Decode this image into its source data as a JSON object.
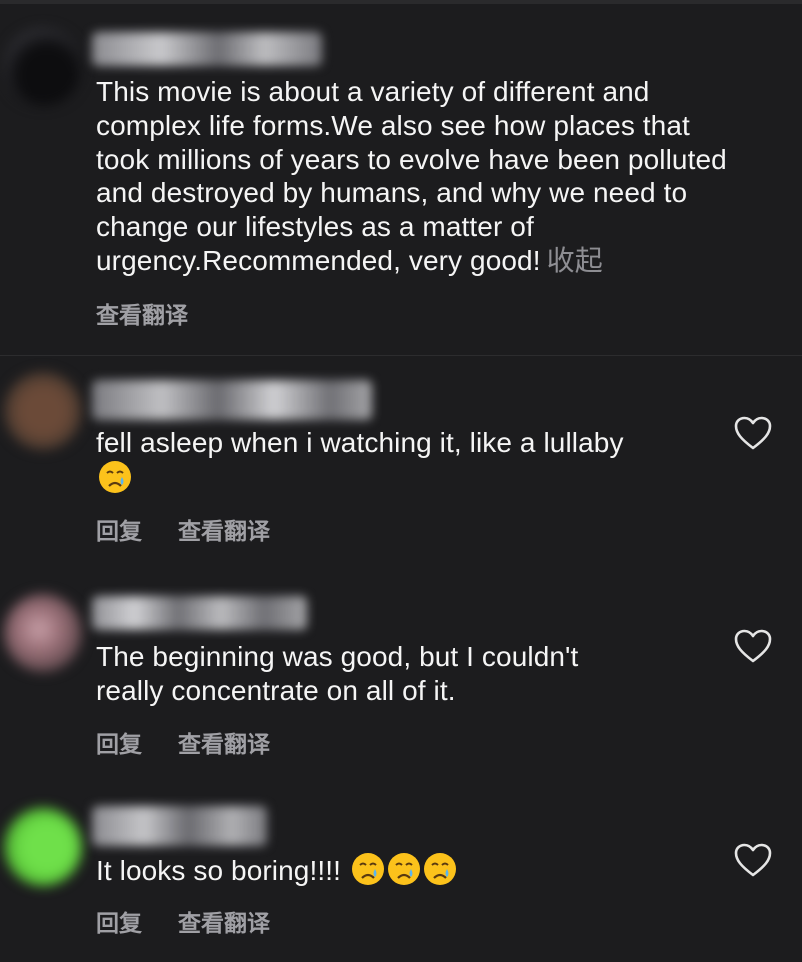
{
  "comments": [
    {
      "text_lines": [
        "This movie is about a variety of different and",
        "complex life forms.We also see how places that",
        "took millions of years to evolve have been polluted",
        "and destroyed by humans, and why we need to",
        "change our lifestyles as a matter of",
        "urgency.Recommended, very good!"
      ],
      "collapse_label": "收起",
      "translate_label": "查看翻译"
    },
    {
      "text": "fell asleep when i watching it, like a lullaby",
      "emoji_icon": "crying-face-icon",
      "reply_label": "回复",
      "translate_label": "查看翻译"
    },
    {
      "text_lines": [
        "The beginning was good, but I couldn't",
        "really concentrate on all of it."
      ],
      "reply_label": "回复",
      "translate_label": "查看翻译"
    },
    {
      "text": "It looks so boring!!!!",
      "emoji_icons": [
        "crying-face-icon",
        "crying-face-icon",
        "crying-face-icon"
      ],
      "reply_label": "回复",
      "translate_label": "查看翻译"
    }
  ],
  "colors": {
    "background": "#1c1c1e",
    "text": "#f5f5f5",
    "secondary": "#a0a0a5",
    "heart_outline": "#e5e5e5"
  }
}
